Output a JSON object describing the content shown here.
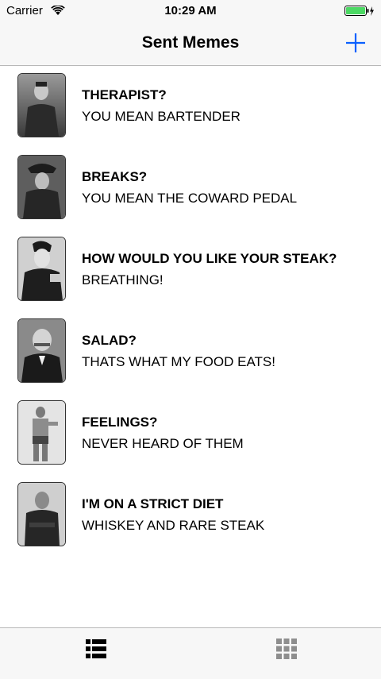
{
  "status_bar": {
    "carrier": "Carrier",
    "time": "10:29 AM",
    "wifi_icon": "wifi-icon",
    "battery_icon": "battery-charging-icon",
    "battery_color": "#4cd964"
  },
  "nav": {
    "title": "Sent Memes",
    "add_icon": "plus-icon",
    "accent_color": "#0a60fe"
  },
  "memes": [
    {
      "top": "THERAPIST?",
      "bottom": "YOU MEAN BARTENDER",
      "thumb_icon": "photo-thumbnail"
    },
    {
      "top": "BREAKS?",
      "bottom": "YOU MEAN THE COWARD PEDAL",
      "thumb_icon": "photo-thumbnail"
    },
    {
      "top": "HOW WOULD YOU LIKE YOUR STEAK?",
      "bottom": "BREATHING!",
      "thumb_icon": "photo-thumbnail"
    },
    {
      "top": "SALAD?",
      "bottom": "THATS WHAT MY FOOD EATS!",
      "thumb_icon": "photo-thumbnail"
    },
    {
      "top": "FEELINGS?",
      "bottom": "NEVER HEARD OF THEM",
      "thumb_icon": "photo-thumbnail"
    },
    {
      "top": "I'M ON A STRICT DIET",
      "bottom": "WHISKEY AND RARE STEAK",
      "thumb_icon": "photo-thumbnail"
    }
  ],
  "tab_bar": {
    "tabs": [
      {
        "icon": "list-icon",
        "selected": true,
        "color": "#000000"
      },
      {
        "icon": "grid-icon",
        "selected": false,
        "color": "#8e8e8e"
      }
    ]
  }
}
